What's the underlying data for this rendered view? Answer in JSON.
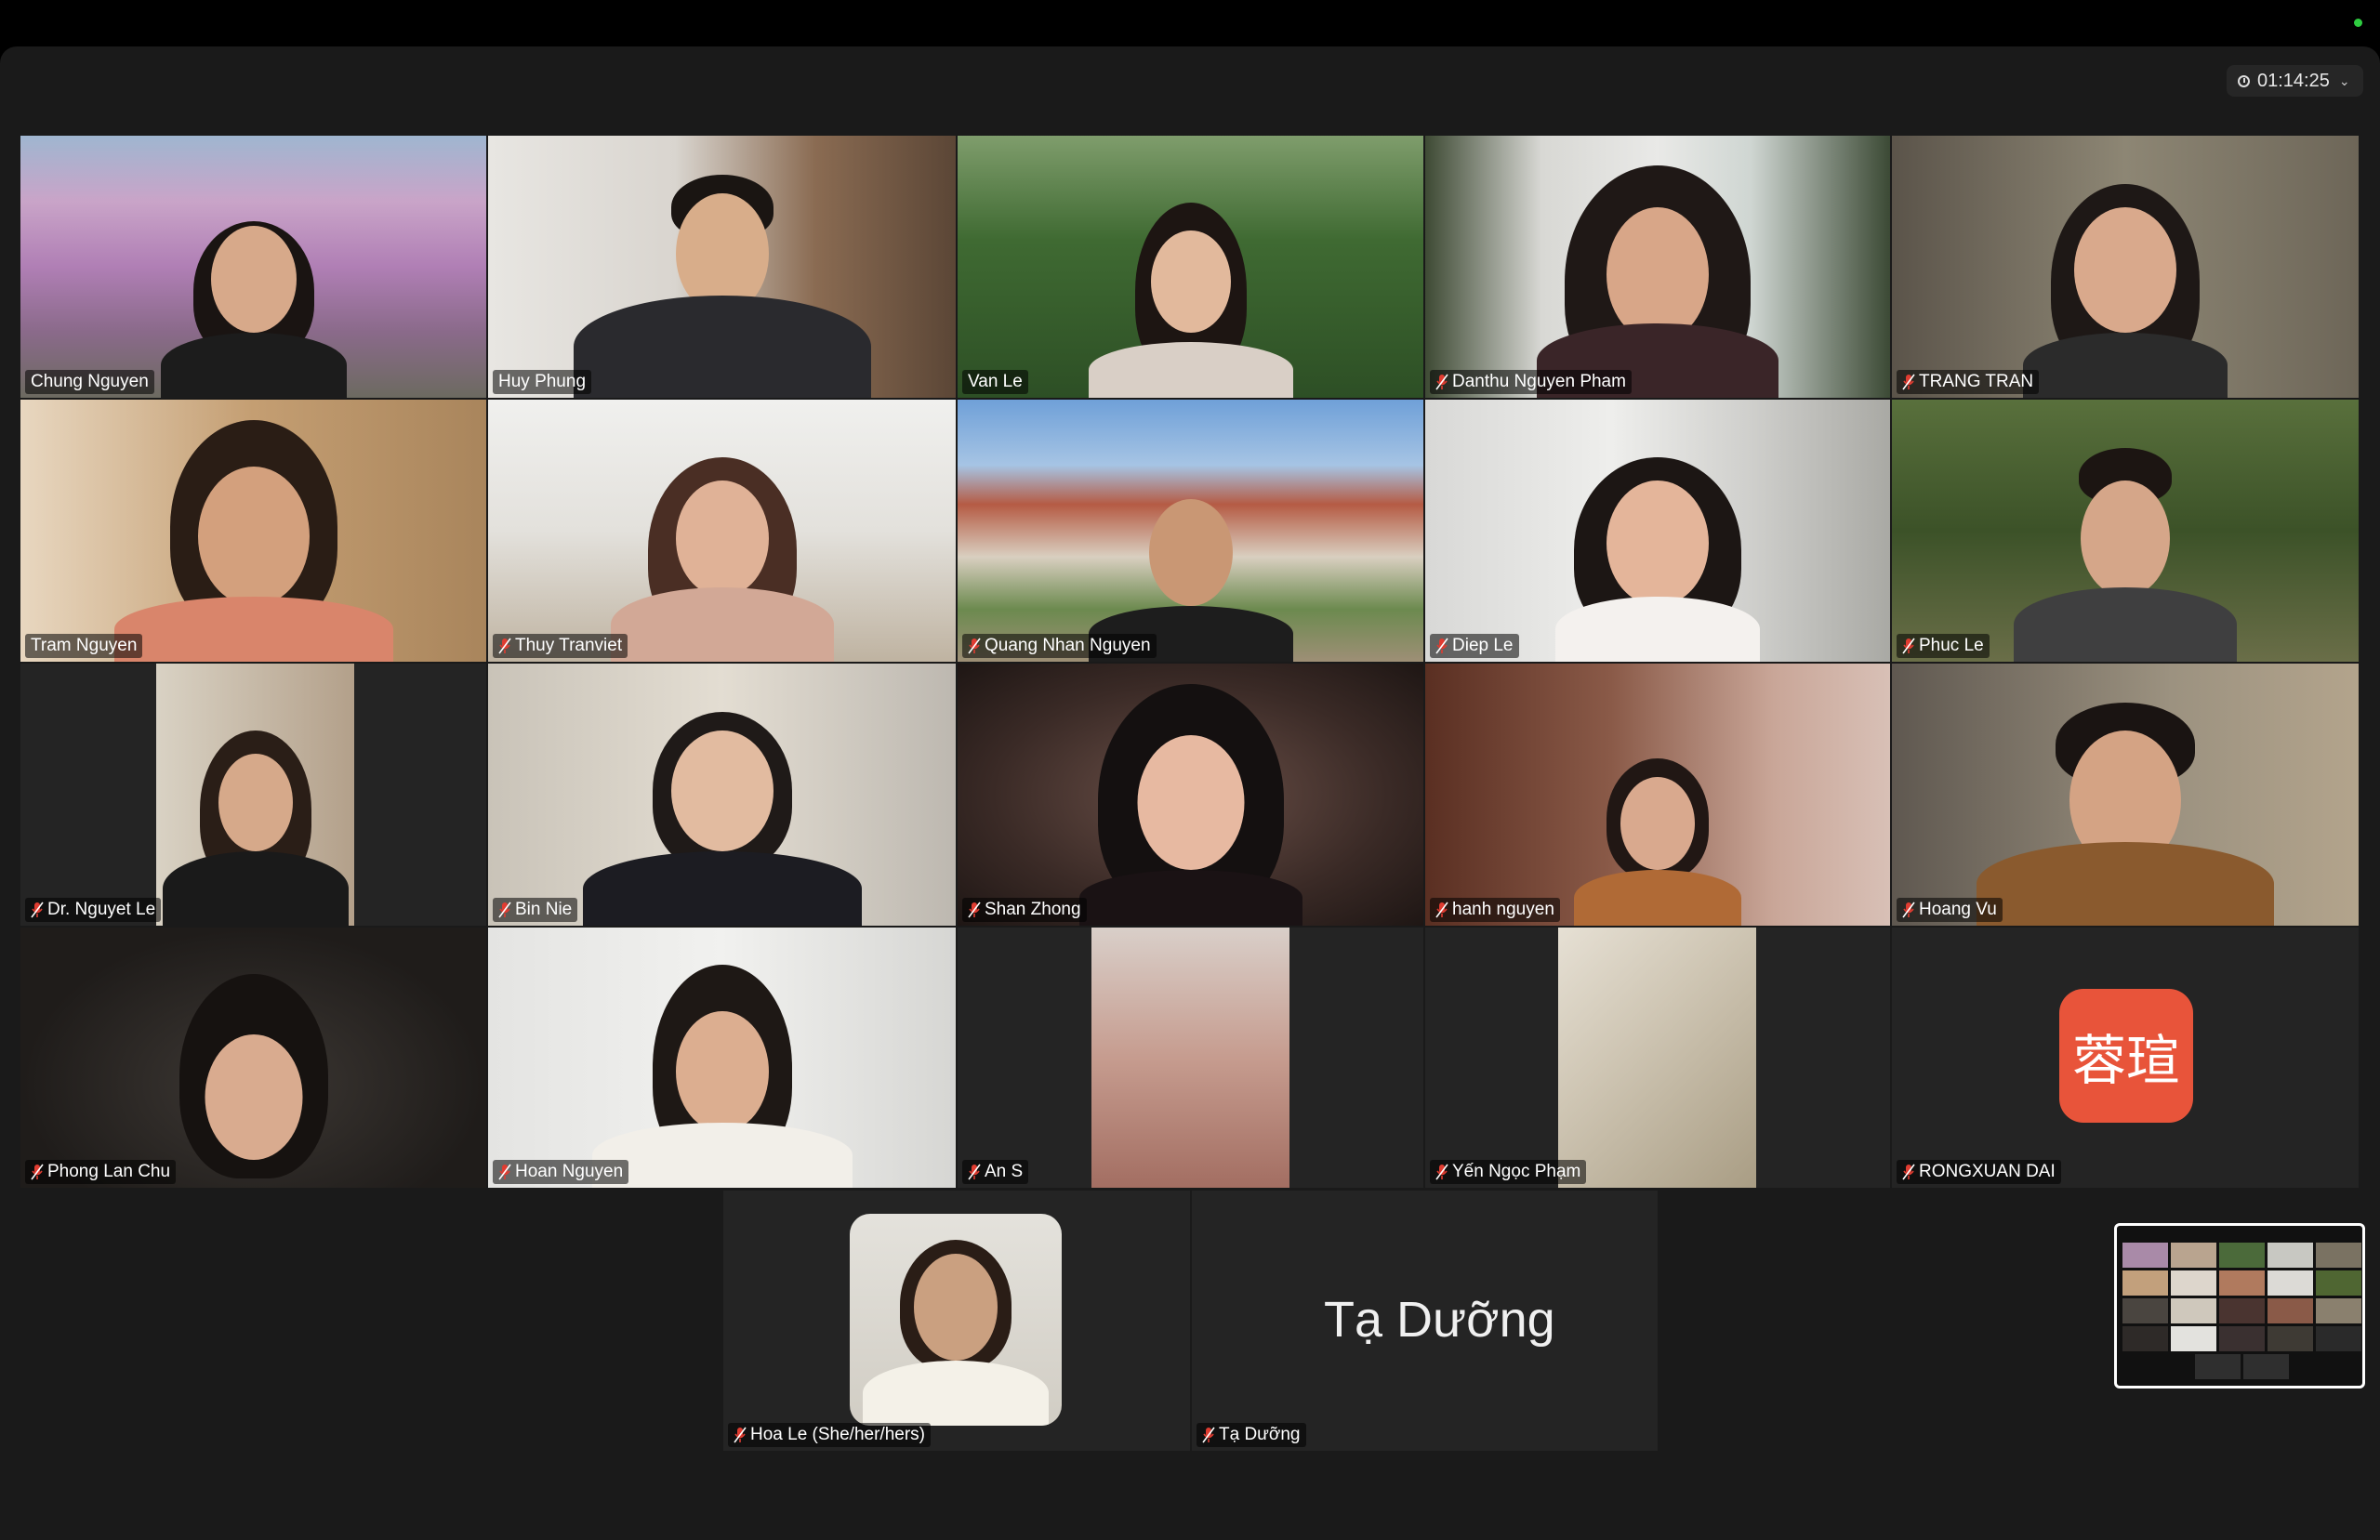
{
  "timer": {
    "elapsed": "01:14:25"
  },
  "participants": [
    {
      "name": "Chung Nguyen",
      "muted": false
    },
    {
      "name": "Huy Phung",
      "muted": false,
      "speaking": true
    },
    {
      "name": "Van Le",
      "muted": false
    },
    {
      "name": "Danthu Nguyen Pham",
      "muted": true
    },
    {
      "name": "TRANG TRAN",
      "muted": true
    },
    {
      "name": "Tram Nguyen",
      "muted": false
    },
    {
      "name": "Thuy Tranviet",
      "muted": true
    },
    {
      "name": "Quang Nhan Nguyen",
      "muted": true
    },
    {
      "name": "Diep Le",
      "muted": true
    },
    {
      "name": "Phuc Le",
      "muted": true
    },
    {
      "name": "Dr. Nguyet Le",
      "muted": true
    },
    {
      "name": "Bin Nie",
      "muted": true
    },
    {
      "name": "Shan Zhong",
      "muted": true
    },
    {
      "name": "hanh nguyen",
      "muted": true
    },
    {
      "name": "Hoang Vu",
      "muted": true
    },
    {
      "name": "Phong Lan Chu",
      "muted": true
    },
    {
      "name": "Hoan Nguyen",
      "muted": true
    },
    {
      "name": "An S",
      "muted": true
    },
    {
      "name": "Yến Ngọc Phạm",
      "muted": true
    },
    {
      "name": "RONGXUAN DAI",
      "muted": true,
      "avatar_text": "蓉瑄"
    },
    {
      "name": "Hoa Le (She/her/hers)",
      "muted": true
    },
    {
      "name": "Tạ Dưỡng",
      "muted": true,
      "display_text": "Tạ Dưỡng"
    }
  ],
  "colors": {
    "active_speaker_border": "#3ec443",
    "avatar_bg": "#e8543a",
    "muted_icon": "#e03c31"
  },
  "icons": {
    "timer": "clock-icon",
    "timer_toggle": "chevron-down-icon",
    "muted": "mic-off-icon"
  }
}
